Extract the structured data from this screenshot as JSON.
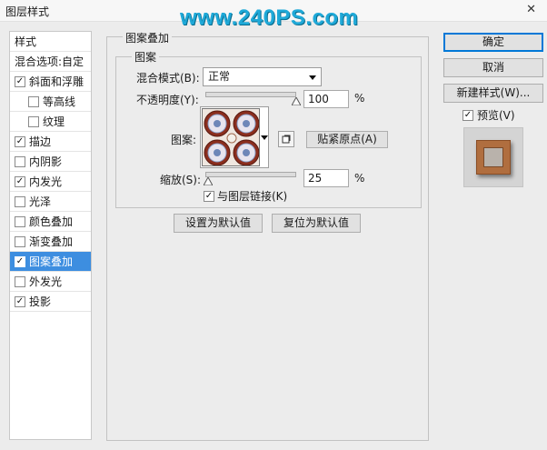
{
  "window": {
    "title": "图层样式",
    "close_glyph": "✕"
  },
  "watermark": "www.240PS.com",
  "style_list": {
    "header": "样式",
    "blend_options": "混合选项:自定",
    "items": [
      {
        "label": "斜面和浮雕",
        "checked": true,
        "sub": false,
        "selected": false
      },
      {
        "label": "等高线",
        "checked": false,
        "sub": true,
        "selected": false
      },
      {
        "label": "纹理",
        "checked": false,
        "sub": true,
        "selected": false
      },
      {
        "label": "描边",
        "checked": true,
        "sub": false,
        "selected": false
      },
      {
        "label": "内阴影",
        "checked": false,
        "sub": false,
        "selected": false
      },
      {
        "label": "内发光",
        "checked": true,
        "sub": false,
        "selected": false
      },
      {
        "label": "光泽",
        "checked": false,
        "sub": false,
        "selected": false
      },
      {
        "label": "颜色叠加",
        "checked": false,
        "sub": false,
        "selected": false
      },
      {
        "label": "渐变叠加",
        "checked": false,
        "sub": false,
        "selected": false
      },
      {
        "label": "图案叠加",
        "checked": true,
        "sub": false,
        "selected": true
      },
      {
        "label": "外发光",
        "checked": false,
        "sub": false,
        "selected": false
      },
      {
        "label": "投影",
        "checked": true,
        "sub": false,
        "selected": false
      }
    ]
  },
  "panel": {
    "group_title": "图案叠加",
    "subgroup_title": "图案",
    "blend_mode_label": "混合模式(B):",
    "blend_mode_value": "正常",
    "opacity_label": "不透明度(Y):",
    "opacity_value": "100",
    "opacity_unit": "%",
    "opacity_fraction": 1.0,
    "pattern_label": "图案:",
    "snap_origin_button": "贴紧原点(A)",
    "scale_label": "缩放(S):",
    "scale_value": "25",
    "scale_unit": "%",
    "scale_fraction": 0.03,
    "link_layer_label": "与图层链接(K)",
    "link_layer_checked": true,
    "set_default_button": "设置为默认值",
    "reset_default_button": "复位为默认值"
  },
  "actions": {
    "ok": "确定",
    "cancel": "取消",
    "new_style": "新建样式(W)...",
    "preview_label": "预览(V)",
    "preview_checked": true
  },
  "colors": {
    "selection": "#3d8ee0",
    "primary_border": "#0078d7",
    "watermark": "#1fa9d8",
    "frame_brown": "#b06e3f"
  },
  "icons": {
    "checkbox_mark": "✓",
    "new_preset": "new-preset-icon"
  }
}
